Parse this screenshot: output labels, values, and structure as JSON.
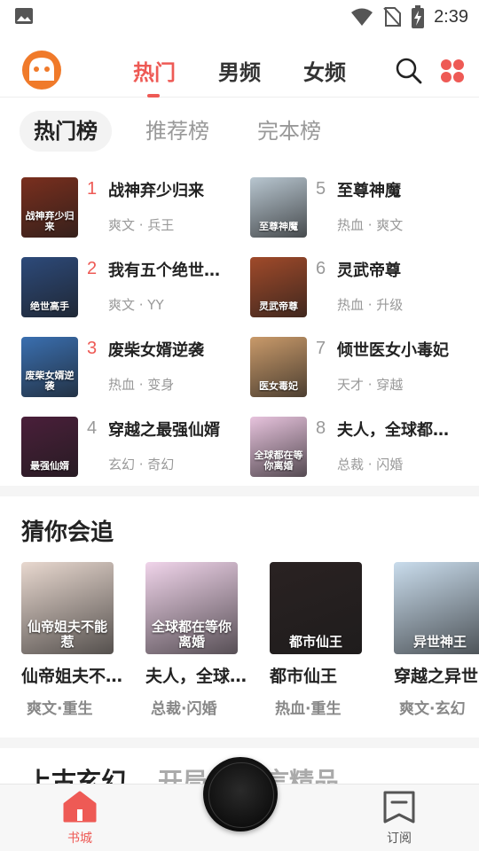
{
  "status_bar": {
    "time": "2:39"
  },
  "top_nav": {
    "tabs": [
      {
        "label": "热门",
        "active": true
      },
      {
        "label": "男频",
        "active": false
      },
      {
        "label": "女频",
        "active": false
      }
    ],
    "icons": [
      "app-logo-icon",
      "search-icon",
      "grid-menu-icon"
    ]
  },
  "rank_tabs": [
    {
      "label": "热门榜",
      "active": true
    },
    {
      "label": "推荐榜",
      "active": false
    },
    {
      "label": "完本榜",
      "active": false
    }
  ],
  "rank_list": [
    {
      "num": "1",
      "title": "战神弃少归来",
      "tags": "爽文 · 兵王",
      "cover_text": "战神弃少归来",
      "cover_color": "#7a2f1e"
    },
    {
      "num": "2",
      "title": "我有五个绝世…",
      "tags": "爽文 · YY",
      "cover_text": "绝世高手",
      "cover_color": "#2d4a7a"
    },
    {
      "num": "3",
      "title": "废柴女婿逆袭",
      "tags": "热血 · 变身",
      "cover_text": "废柴女婿逆袭",
      "cover_color": "#3a6fb0"
    },
    {
      "num": "4",
      "title": "穿越之最强仙婿",
      "tags": "玄幻 · 奇幻",
      "cover_text": "最强仙婿",
      "cover_color": "#4a1f3a"
    },
    {
      "num": "5",
      "title": "至尊神魔",
      "tags": "热血 · 爽文",
      "cover_text": "至尊神魔",
      "cover_color": "#b8c6d0"
    },
    {
      "num": "6",
      "title": "灵武帝尊",
      "tags": "热血 · 升级",
      "cover_text": "灵武帝尊",
      "cover_color": "#a04a2a"
    },
    {
      "num": "7",
      "title": "倾世医女小毒妃",
      "tags": "天才 · 穿越",
      "cover_text": "医女毒妃",
      "cover_color": "#c99a6a"
    },
    {
      "num": "8",
      "title": "夫人，全球都…",
      "tags": "总裁 · 闪婚",
      "cover_text": "全球都在等你离婚",
      "cover_color": "#e7c3dd"
    }
  ],
  "guess_section": {
    "title": "猜你会追",
    "items": [
      {
        "title": "仙帝姐夫不…",
        "tags": "爽文·重生",
        "cover_text": "仙帝姐夫不能惹",
        "cover_color": "#e8d8cf"
      },
      {
        "title": "夫人，全球…",
        "tags": "总裁·闪婚",
        "cover_text": "全球都在等你离婚",
        "cover_color": "#f0d4ea"
      },
      {
        "title": "都市仙王",
        "tags": "热血·重生",
        "cover_text": "都市仙王",
        "cover_color": "#2a2222"
      },
      {
        "title": "穿越之异世",
        "tags": "爽文·玄幻",
        "cover_text": "异世神王",
        "cover_color": "#c9dcec"
      }
    ]
  },
  "more_tabs": [
    {
      "label": "上古玄幻",
      "dim": false
    },
    {
      "label": "开局",
      "dim": true
    },
    {
      "label": "古言精品",
      "dim": true
    }
  ],
  "bottom_bar": {
    "left": {
      "label": "书城",
      "color": "#ee5a55"
    },
    "right": {
      "label": "订阅",
      "color": "#555555"
    }
  },
  "colors": {
    "accent": "#ee5a55",
    "muted": "#999999"
  }
}
